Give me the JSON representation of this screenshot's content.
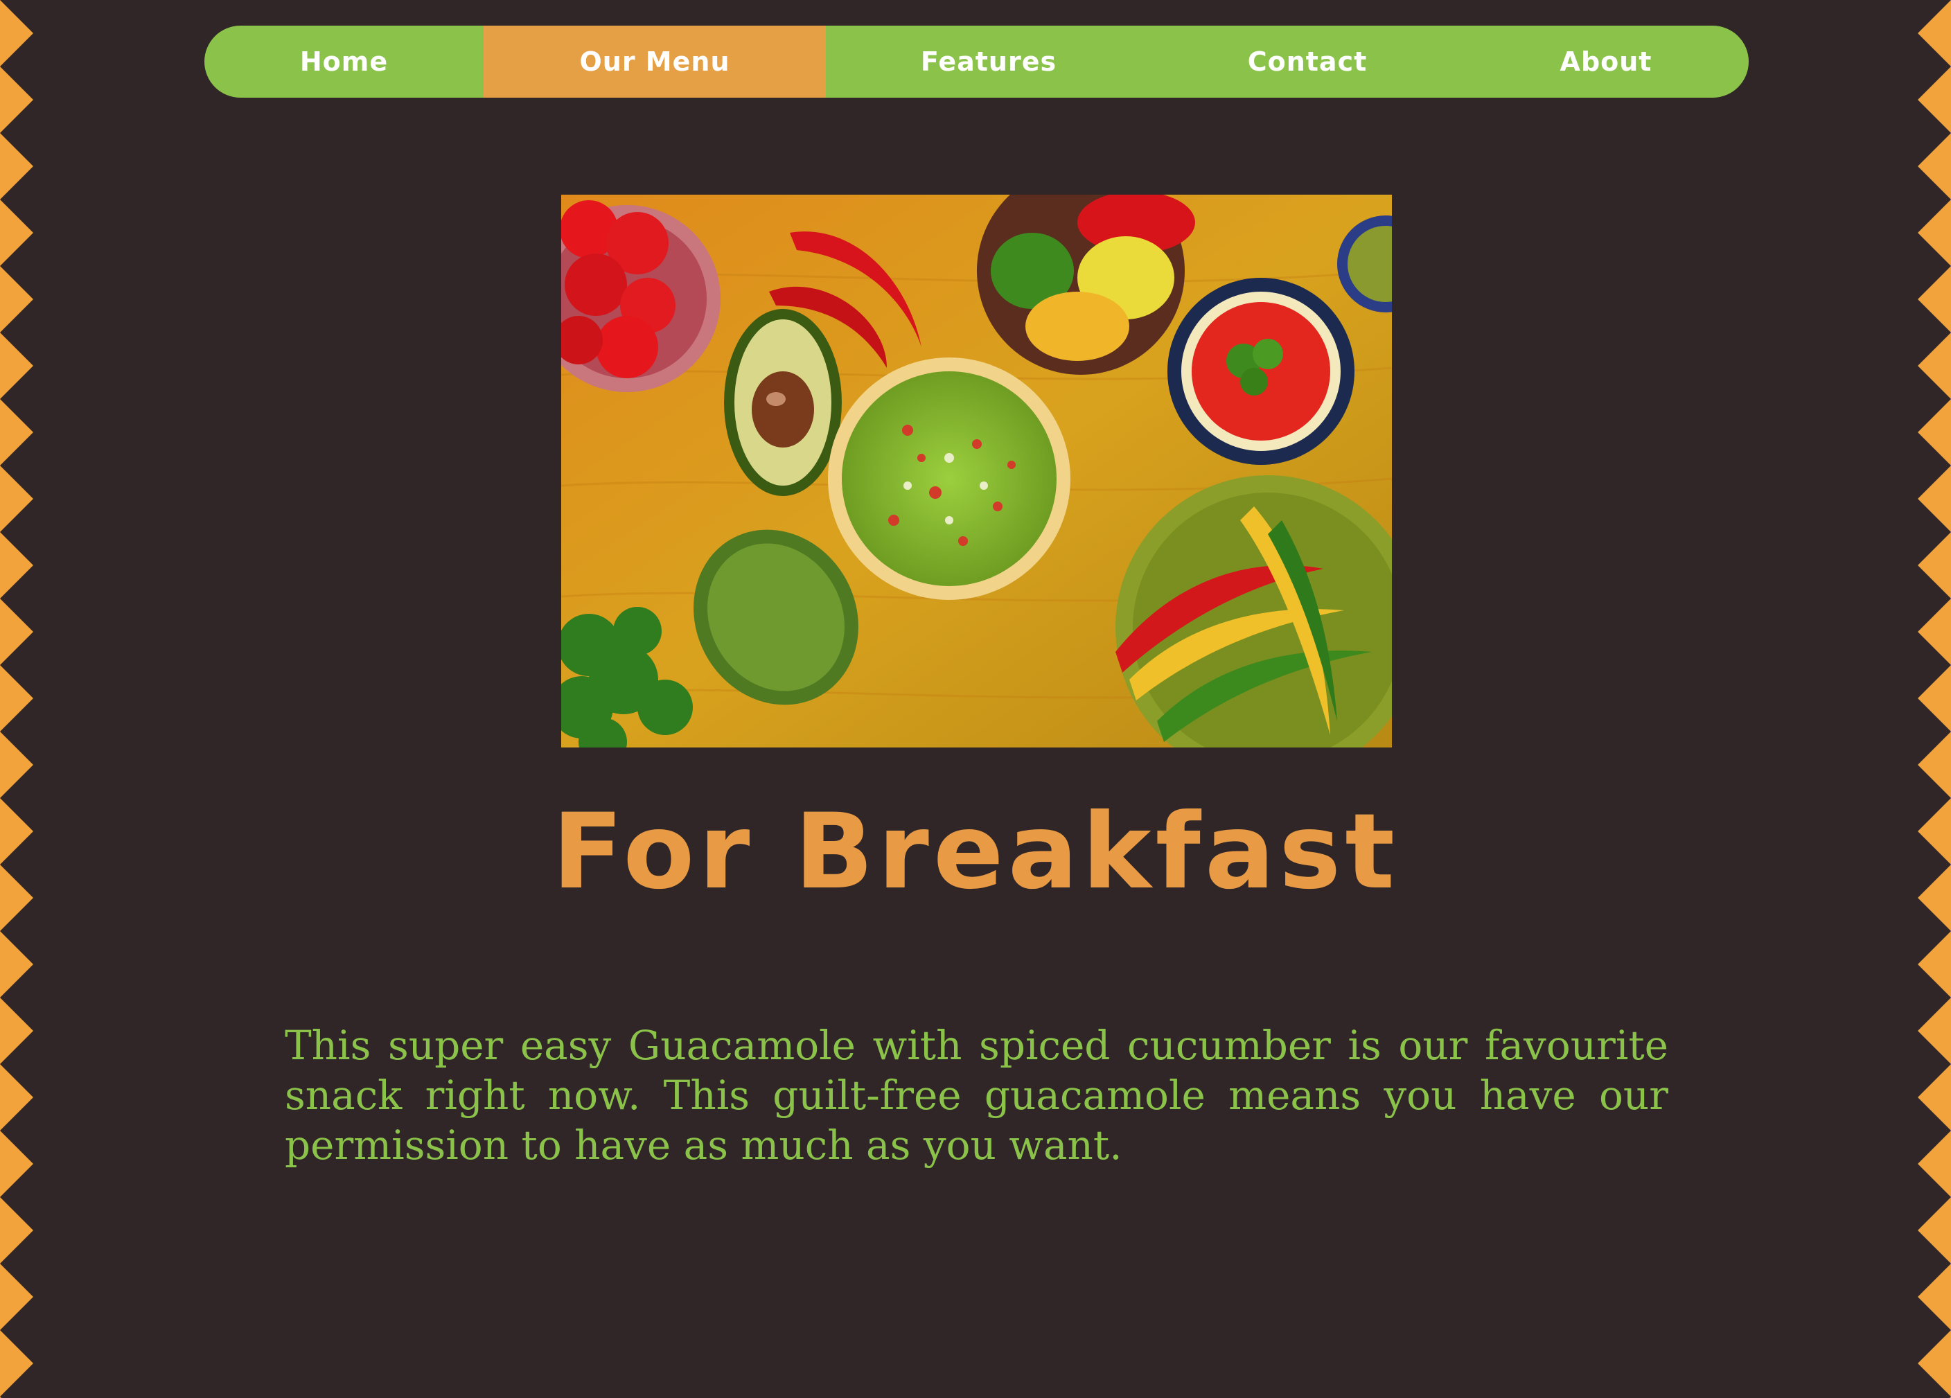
{
  "nav": {
    "items": [
      {
        "label": "Home"
      },
      {
        "label": "Our Menu",
        "active": true
      },
      {
        "label": "Features"
      },
      {
        "label": "Contact"
      },
      {
        "label": "About"
      }
    ]
  },
  "hero": {
    "image_icon": "food-photo-icon"
  },
  "section": {
    "heading": "For Breakfast",
    "description": "This super easy Guacamole with spiced cucumber is our favourite snack right now. This guilt-free guacamole means you have our permission to have as much as you want."
  },
  "colors": {
    "background": "#302627",
    "accent_green": "#8bc34a",
    "accent_orange": "#e5a046",
    "heading_orange": "#e89a44"
  }
}
